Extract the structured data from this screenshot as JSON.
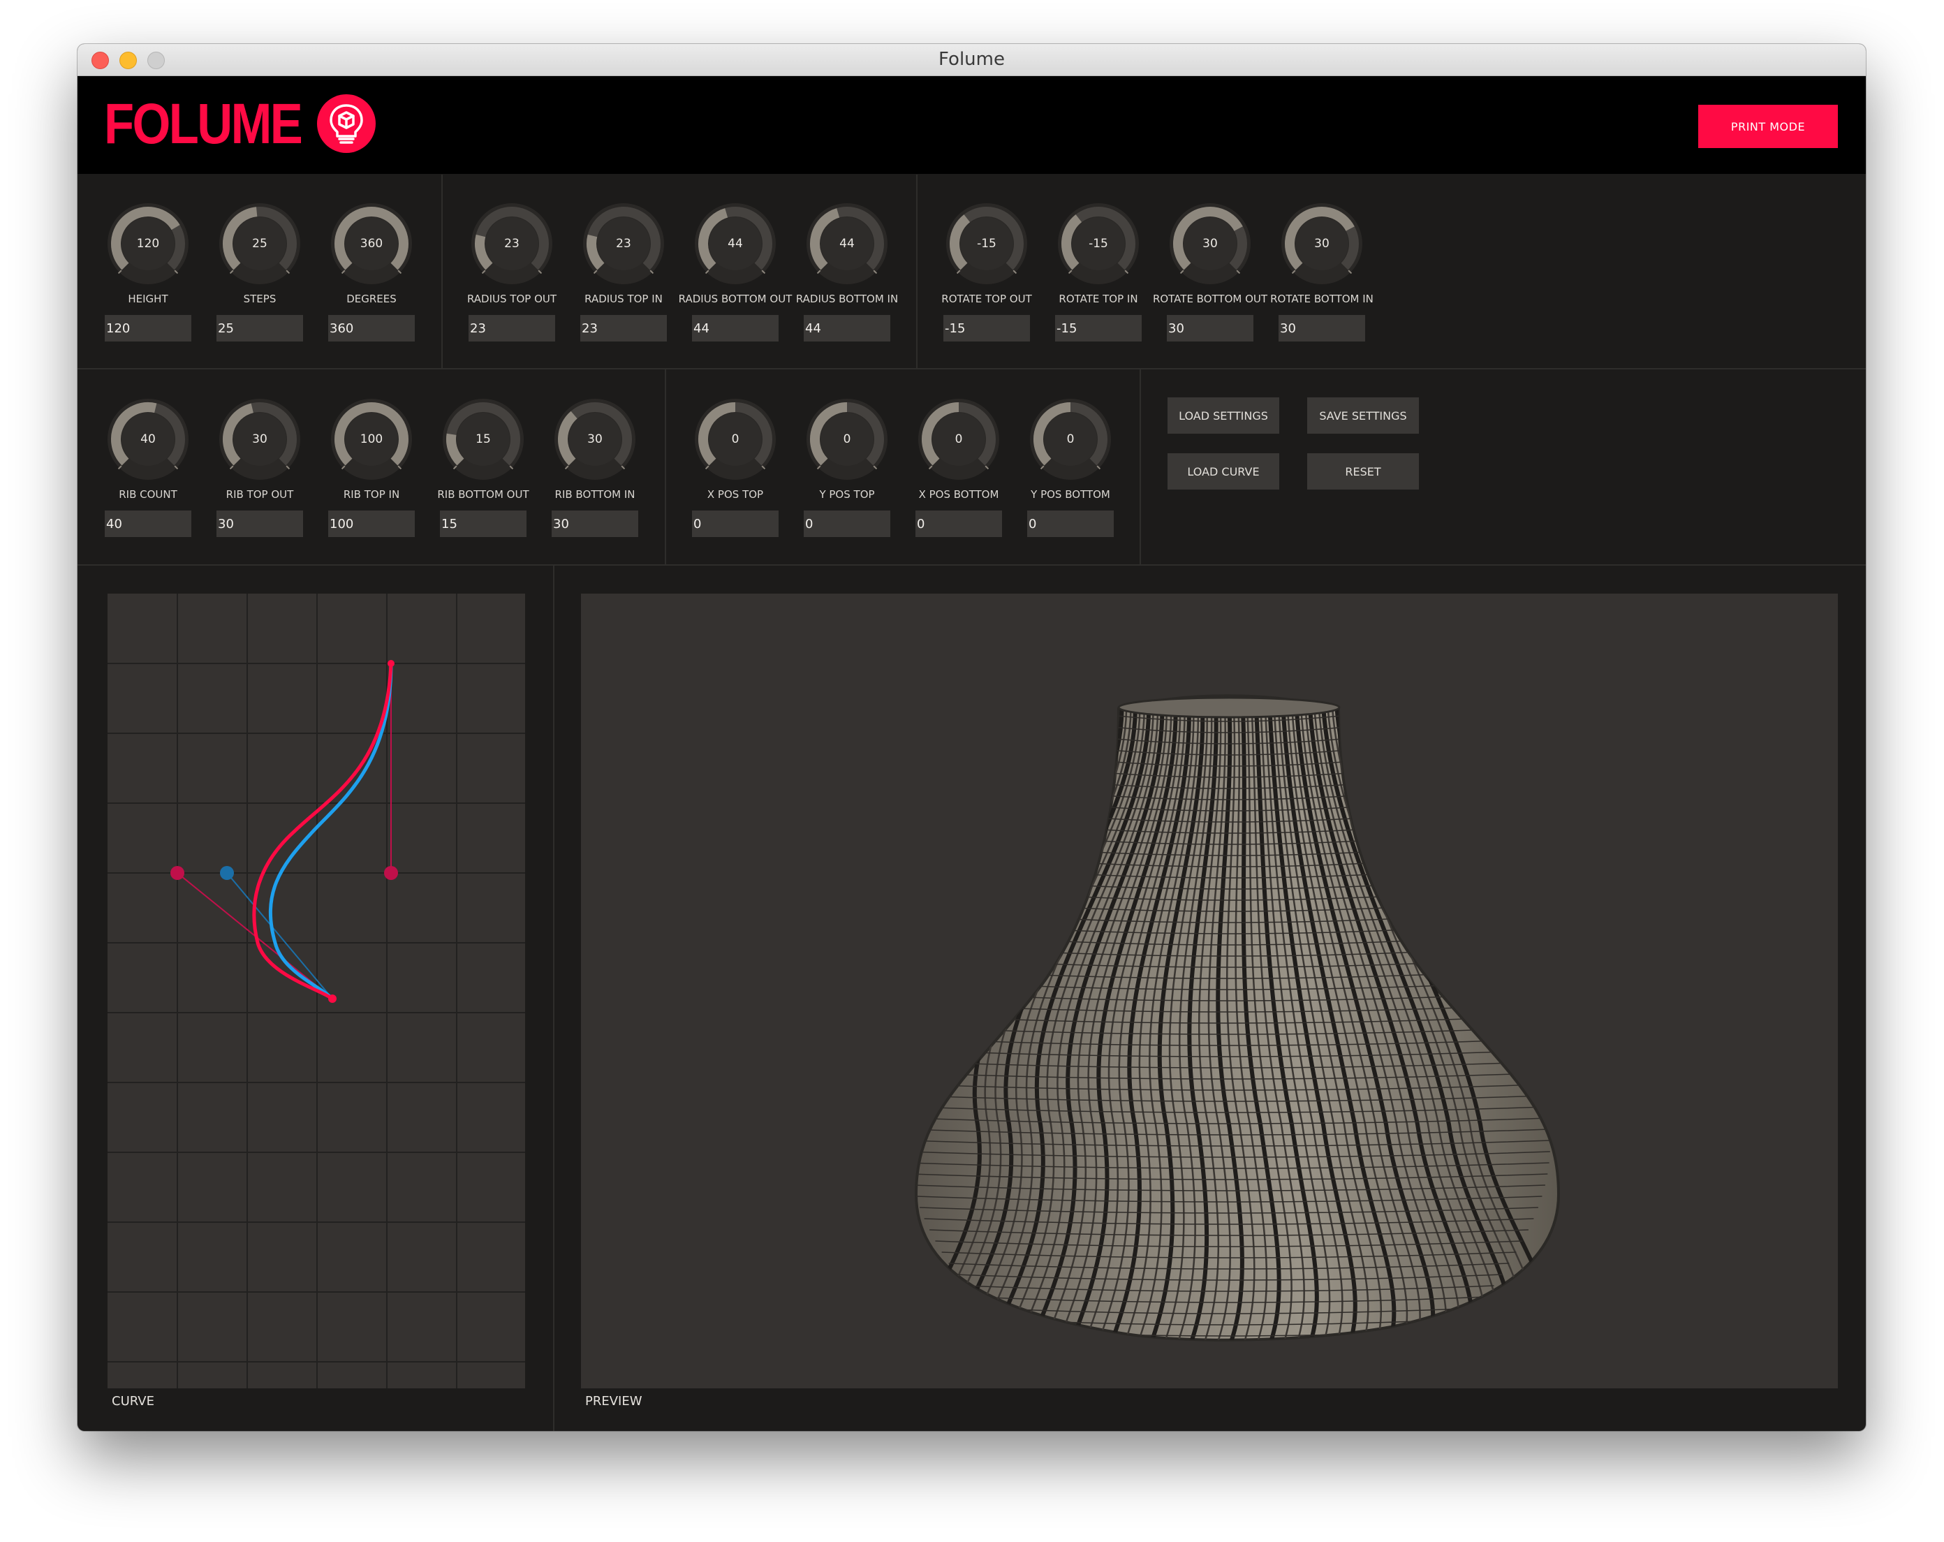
{
  "window": {
    "title": "Folume"
  },
  "header": {
    "logo_text": "FOLUME",
    "logo_icon": "lightbulb-cube-icon",
    "print_mode_label": "PRINT MODE"
  },
  "accent_color": "#ff0a44",
  "controls": [
    {
      "id": "height",
      "label": "HEIGHT",
      "value": "120",
      "fill": 0.72
    },
    {
      "id": "steps",
      "label": "STEPS",
      "value": "25",
      "fill": 0.48
    },
    {
      "id": "degrees",
      "label": "DEGREES",
      "value": "360",
      "fill": 1.0
    },
    {
      "id": "radius-top-out",
      "label": "RADIUS TOP OUT",
      "value": "23",
      "fill": 0.22
    },
    {
      "id": "radius-top-in",
      "label": "RADIUS TOP IN",
      "value": "23",
      "fill": 0.22
    },
    {
      "id": "radius-bottom-out",
      "label": "RADIUS BOTTOM OUT",
      "value": "44",
      "fill": 0.44
    },
    {
      "id": "radius-bottom-in",
      "label": "RADIUS BOTTOM IN",
      "value": "44",
      "fill": 0.44
    },
    {
      "id": "rotate-top-out",
      "label": "ROTATE TOP OUT",
      "value": "-15",
      "fill": 0.36
    },
    {
      "id": "rotate-top-in",
      "label": "ROTATE TOP IN",
      "value": "-15",
      "fill": 0.36
    },
    {
      "id": "rotate-bottom-out",
      "label": "ROTATE BOTTOM OUT",
      "value": "30",
      "fill": 0.73
    },
    {
      "id": "rotate-bottom-in",
      "label": "ROTATE BOTTOM IN",
      "value": "30",
      "fill": 0.73
    },
    {
      "id": "rib-count",
      "label": "RIB COUNT",
      "value": "40",
      "fill": 0.55
    },
    {
      "id": "rib-top-out",
      "label": "RIB TOP OUT",
      "value": "30",
      "fill": 0.45
    },
    {
      "id": "rib-top-in",
      "label": "RIB TOP IN",
      "value": "100",
      "fill": 1.0
    },
    {
      "id": "rib-bottom-out",
      "label": "RIB BOTTOM OUT",
      "value": "15",
      "fill": 0.2
    },
    {
      "id": "rib-bottom-in",
      "label": "RIB BOTTOM IN",
      "value": "30",
      "fill": 0.35
    },
    {
      "id": "x-pos-top",
      "label": "X POS TOP",
      "value": "0",
      "fill": 0.5
    },
    {
      "id": "y-pos-top",
      "label": "Y POS TOP",
      "value": "0",
      "fill": 0.5
    },
    {
      "id": "x-pos-bottom",
      "label": "X POS BOTTOM",
      "value": "0",
      "fill": 0.5
    },
    {
      "id": "y-pos-bottom",
      "label": "Y POS BOTTOM",
      "value": "0",
      "fill": 0.5
    }
  ],
  "buttons": {
    "load_settings": "LOAD SETTINGS",
    "save_settings": "SAVE SETTINGS",
    "load_curve": "LOAD CURVE",
    "reset": "RESET"
  },
  "canvases": {
    "curve_label": "CURVE",
    "preview_label": "PREVIEW"
  },
  "curve_colors": {
    "outer": "#ff0a44",
    "inner": "#1ea0ee",
    "handle_outer": "#c0104a",
    "handle_inner": "#1b6fa8"
  }
}
